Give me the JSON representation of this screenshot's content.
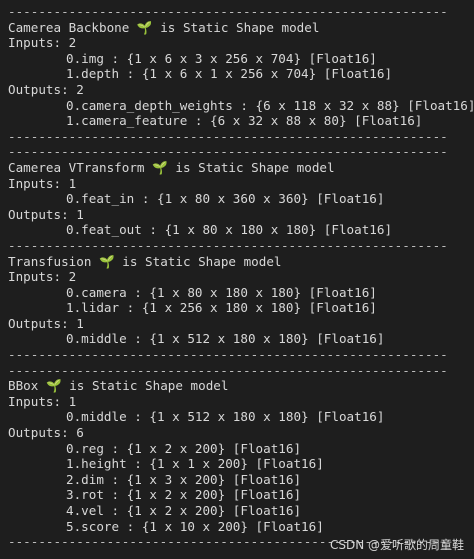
{
  "lines": [
    {
      "type": "sep",
      "text": "----------------------------------------------------------"
    },
    {
      "type": "header",
      "name": "Camerea Backbone",
      "icon": "🌱",
      "suffix": "is Static Shape model"
    },
    {
      "type": "plain",
      "text": "Inputs: 2"
    },
    {
      "type": "indent",
      "text": "0.img : {1 x 6 x 3 x 256 x 704} [Float16]"
    },
    {
      "type": "indent",
      "text": "1.depth : {1 x 6 x 1 x 256 x 704} [Float16]"
    },
    {
      "type": "plain",
      "text": "Outputs: 2"
    },
    {
      "type": "indent",
      "text": "0.camera_depth_weights : {6 x 118 x 32 x 88} [Float16]"
    },
    {
      "type": "indent",
      "text": "1.camera_feature : {6 x 32 x 88 x 80} [Float16]"
    },
    {
      "type": "sep",
      "text": "----------------------------------------------------------"
    },
    {
      "type": "sep",
      "text": "----------------------------------------------------------"
    },
    {
      "type": "header",
      "name": "Camerea VTransform",
      "icon": "🌱",
      "suffix": "is Static Shape model"
    },
    {
      "type": "plain",
      "text": "Inputs: 1"
    },
    {
      "type": "indent",
      "text": "0.feat_in : {1 x 80 x 360 x 360} [Float16]"
    },
    {
      "type": "plain",
      "text": "Outputs: 1"
    },
    {
      "type": "indent",
      "text": "0.feat_out : {1 x 80 x 180 x 180} [Float16]"
    },
    {
      "type": "sep",
      "text": "----------------------------------------------------------"
    },
    {
      "type": "header",
      "name": "Transfusion",
      "icon": "🌱",
      "suffix": "is Static Shape model"
    },
    {
      "type": "plain",
      "text": "Inputs: 2"
    },
    {
      "type": "indent",
      "text": "0.camera : {1 x 80 x 180 x 180} [Float16]"
    },
    {
      "type": "indent",
      "text": "1.lidar : {1 x 256 x 180 x 180} [Float16]"
    },
    {
      "type": "plain",
      "text": "Outputs: 1"
    },
    {
      "type": "indent",
      "text": "0.middle : {1 x 512 x 180 x 180} [Float16]"
    },
    {
      "type": "sep",
      "text": "----------------------------------------------------------"
    },
    {
      "type": "sep",
      "text": "----------------------------------------------------------"
    },
    {
      "type": "header",
      "name": "BBox",
      "icon": "🌱",
      "suffix": "is Static Shape model"
    },
    {
      "type": "plain",
      "text": "Inputs: 1"
    },
    {
      "type": "indent",
      "text": "0.middle : {1 x 512 x 180 x 180} [Float16]"
    },
    {
      "type": "plain",
      "text": "Outputs: 6"
    },
    {
      "type": "indent",
      "text": "0.reg : {1 x 2 x 200} [Float16]"
    },
    {
      "type": "indent",
      "text": "1.height : {1 x 1 x 200} [Float16]"
    },
    {
      "type": "indent",
      "text": "2.dim : {1 x 3 x 200} [Float16]"
    },
    {
      "type": "indent",
      "text": "3.rot : {1 x 2 x 200} [Float16]"
    },
    {
      "type": "indent",
      "text": "4.vel : {1 x 2 x 200} [Float16]"
    },
    {
      "type": "indent",
      "text": "5.score : {1 x 10 x 200} [Float16]"
    },
    {
      "type": "sep",
      "text": "----------------------------------------------------------"
    }
  ],
  "watermark": "CSDN @爱听歌的周童鞋",
  "colors": {
    "background": "#1e1e1e",
    "text": "#d8d8d8",
    "sprout": "#6cc04a"
  }
}
